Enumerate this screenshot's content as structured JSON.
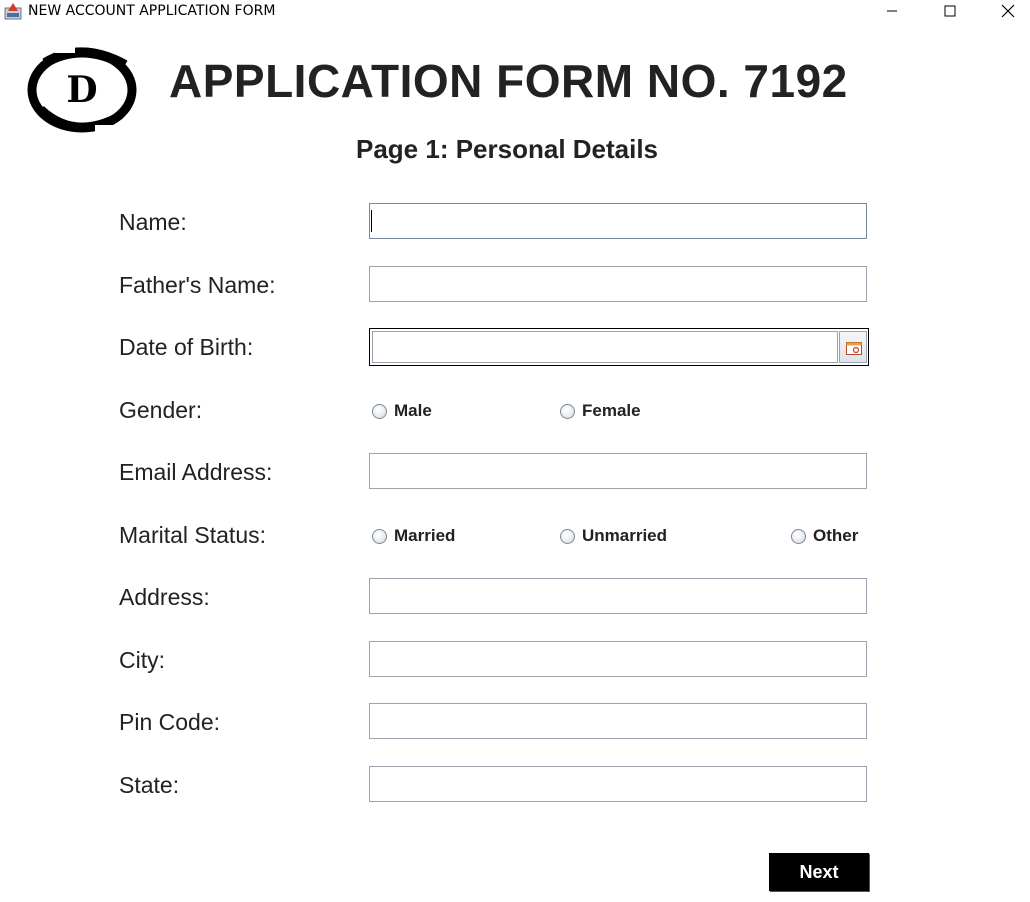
{
  "window": {
    "title": "NEW ACCOUNT APPLICATION FORM"
  },
  "header": {
    "logo_letter": "D",
    "form_title": "APPLICATION FORM NO. 7192",
    "page_subtitle": "Page 1: Personal Details"
  },
  "fields": {
    "name_label": "Name:",
    "name_value": "",
    "father_name_label": "Father's Name:",
    "father_name_value": "",
    "dob_label": "Date of Birth:",
    "dob_value": "",
    "gender_label": "Gender:",
    "gender_options": [
      "Male",
      "Female"
    ],
    "email_label": "Email Address:",
    "email_value": "",
    "marital_label": "Marital Status:",
    "marital_options": [
      "Married",
      "Unmarried",
      "Other"
    ],
    "address_label": "Address:",
    "address_value": "",
    "city_label": "City:",
    "city_value": "",
    "pin_label": "Pin Code:",
    "pin_value": "",
    "state_label": "State:",
    "state_value": ""
  },
  "actions": {
    "next_label": "Next"
  },
  "icons": {
    "app": "java-app-icon",
    "minimize": "minimize-icon",
    "maximize": "maximize-icon",
    "close": "close-icon",
    "calendar": "calendar-icon"
  },
  "colors": {
    "text": "#222222",
    "input_border": "#9aa3ae",
    "button_bg": "#000000",
    "button_text": "#ffffff"
  }
}
